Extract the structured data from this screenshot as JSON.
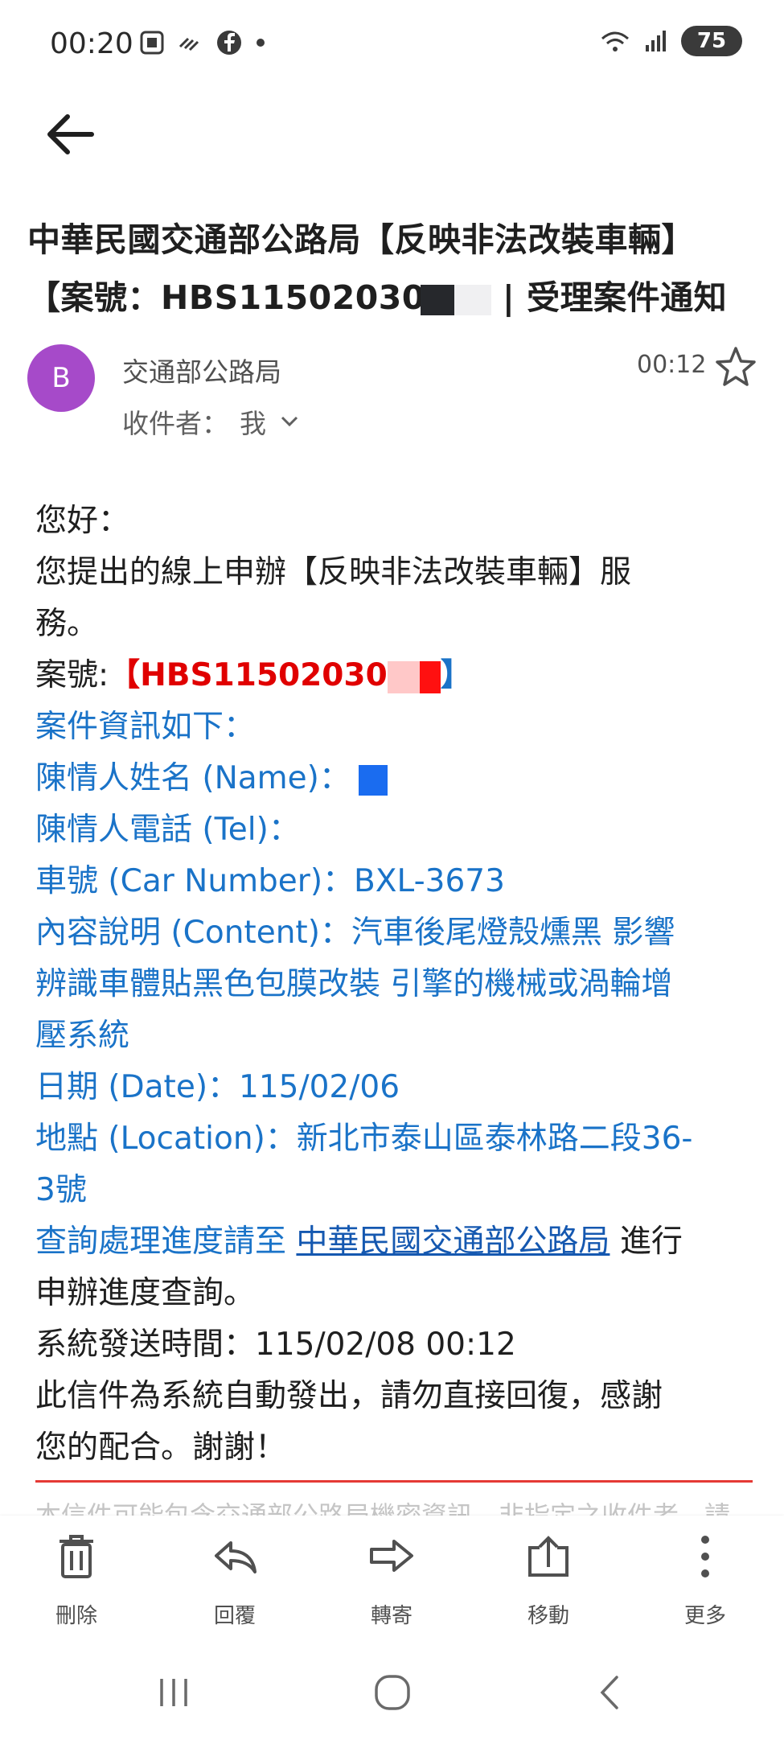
{
  "status_bar": {
    "time": "00:20",
    "battery": "75",
    "network": "5"
  },
  "email": {
    "subject_line1": "中華民國交通部公路局【反映非法改裝車輛】",
    "subject_line2_prefix": "【案號：HBS11502030",
    "subject_line2_suffix": "| 受理案件通知",
    "sender_initial": "B",
    "sender_name": "交通部公路局",
    "recipient_label": "收件者：",
    "recipient_value": "我",
    "time": "00:12"
  },
  "body": {
    "greeting": "您好：",
    "intro_line1": "您提出的線上申辦【反映非法改裝車輛】服",
    "intro_line2": "務。",
    "case_label": "案號:",
    "case_open": "【",
    "case_number": "HBS11502030",
    "case_close": "】",
    "info_header": "案件資訊如下：",
    "name_label": "陳情人姓名 (Name)：",
    "tel_label": "陳情人電話 (Tel)：",
    "car_number": "車號 (Car Number)：BXL-3673",
    "content_line1": "內容說明 (Content)：汽車後尾燈殼燻黑 影響",
    "content_line2": "辨識車體貼黑色包膜改裝 引擎的機械或渦輪增",
    "content_line3": "壓系統",
    "date": "日期 (Date)：115/02/06",
    "location_line1": "地點 (Location)：新北市泰山區泰林路二段36-",
    "location_line2": "3號",
    "query_prefix": "查詢處理進度請至",
    "query_link": "中華民國交通部公路局",
    "query_suffix": "進行",
    "query_line2": "申辦進度查詢。",
    "sent_time": "系統發送時間：115/02/08 00:12",
    "auto_line1": "此信件為系統自動發出，請勿直接回復，感謝",
    "auto_line2": "您的配合。謝謝！",
    "footer_faded": "本信件可能包含交通部公路局機密資訊，非指定之收件者，請"
  },
  "actions": [
    {
      "label": "刪除"
    },
    {
      "label": "回覆"
    },
    {
      "label": "轉寄"
    },
    {
      "label": "移動"
    },
    {
      "label": "更多"
    }
  ],
  "colors": {
    "avatar": "#a64ac9",
    "link_blue": "#1a73c8",
    "case_red": "#e00000",
    "divider_red": "#e53935"
  },
  "icons": [
    "arrow-left-icon",
    "star-icon",
    "chevron-down-icon",
    "trash-icon",
    "reply-icon",
    "forward-icon",
    "move-icon",
    "more-vert-icon",
    "recents-icon",
    "home-icon",
    "back-icon"
  ]
}
